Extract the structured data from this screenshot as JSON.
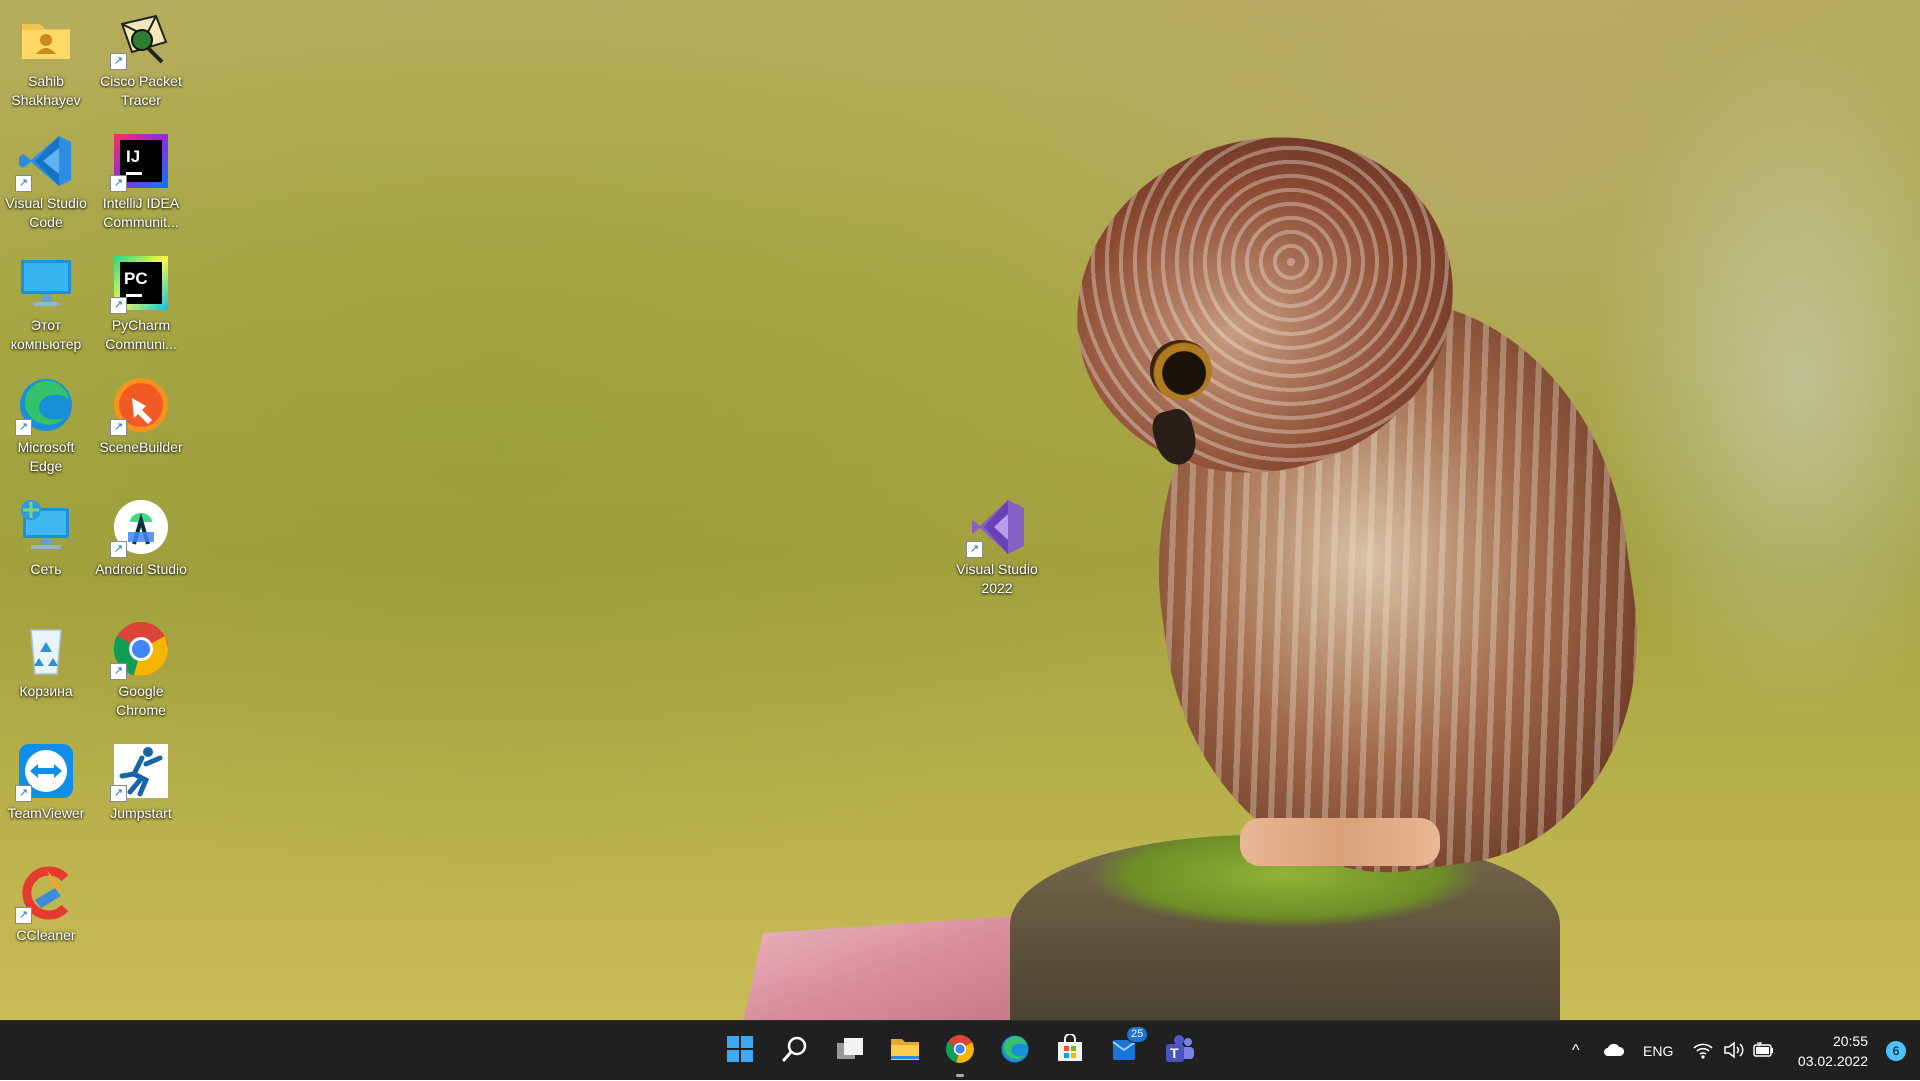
{
  "desktop": {
    "icons": [
      {
        "label": "Sahib Shakhayev",
        "icon": "user-folder-icon"
      },
      {
        "label": "Cisco Packet Tracer",
        "icon": "cisco-packet-tracer-icon"
      },
      {
        "label": "Visual Studio Code",
        "icon": "vscode-icon"
      },
      {
        "label": "IntelliJ IDEA Communit...",
        "icon": "intellij-icon"
      },
      {
        "label": "Этот компьютер",
        "icon": "this-pc-icon"
      },
      {
        "label": "PyCharm Communi...",
        "icon": "pycharm-icon"
      },
      {
        "label": "Microsoft Edge",
        "icon": "edge-icon"
      },
      {
        "label": "SceneBuilder",
        "icon": "scenebuilder-icon"
      },
      {
        "label": "Сеть",
        "icon": "network-icon"
      },
      {
        "label": "Android Studio",
        "icon": "android-studio-icon"
      },
      {
        "label": "Корзина",
        "icon": "recycle-bin-icon"
      },
      {
        "label": "Google Chrome",
        "icon": "chrome-icon"
      },
      {
        "label": "TeamViewer",
        "icon": "teamviewer-icon"
      },
      {
        "label": "Jumpstart",
        "icon": "jumpstart-icon"
      },
      {
        "label": "CCleaner",
        "icon": "ccleaner-icon"
      },
      {
        "label": "Visual Studio 2022",
        "icon": "visual-studio-icon"
      }
    ],
    "intellij_glyph": "IJ",
    "pycharm_glyph": "PC",
    "shortcut_glyph": "↗"
  },
  "taskbar": {
    "apps": [
      {
        "name": "start",
        "icon": "windows-start-icon"
      },
      {
        "name": "search",
        "icon": "search-icon"
      },
      {
        "name": "task-view",
        "icon": "task-view-icon"
      },
      {
        "name": "file-explorer",
        "icon": "folder-icon"
      },
      {
        "name": "chrome",
        "icon": "chrome-icon"
      },
      {
        "name": "edge",
        "icon": "edge-icon"
      },
      {
        "name": "store",
        "icon": "store-icon"
      },
      {
        "name": "mail",
        "icon": "mail-icon"
      },
      {
        "name": "teams",
        "icon": "teams-icon"
      }
    ],
    "mail_badge": "25",
    "teams_glyph": "T",
    "tray": {
      "chevron": "^",
      "language": "ENG",
      "time": "20:55",
      "date": "03.02.2022",
      "notification_count": "6"
    }
  },
  "colors": {
    "taskbar_bg": "#202020",
    "accent": "#4cc2ff"
  }
}
